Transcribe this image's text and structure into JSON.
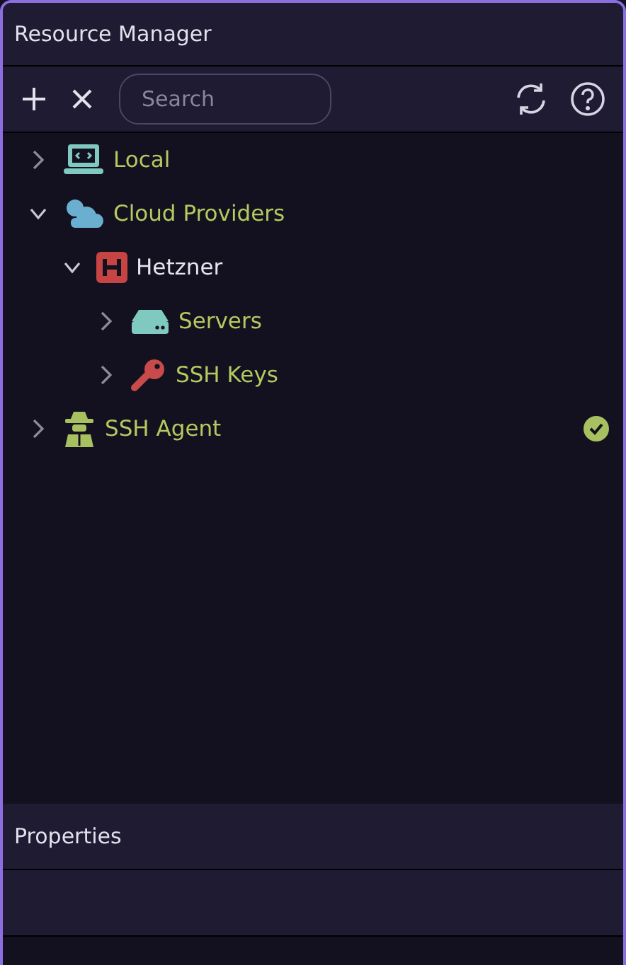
{
  "window": {
    "title": "Resource Manager"
  },
  "toolbar": {
    "search": {
      "placeholder": "Search"
    }
  },
  "tree": [
    {
      "label": "Local",
      "kind": "local",
      "expanded": false,
      "connected": false
    },
    {
      "label": "Cloud Providers",
      "kind": "cloud",
      "expanded": true,
      "connected": false,
      "children": [
        {
          "label": "Hetzner",
          "kind": "provider",
          "expanded": true,
          "connected": false,
          "children": [
            {
              "label": "Servers",
              "kind": "servers",
              "expanded": false,
              "connected": false
            },
            {
              "label": "SSH Keys",
              "kind": "keys",
              "expanded": false,
              "connected": false
            }
          ]
        }
      ]
    },
    {
      "label": "SSH Agent",
      "kind": "agent",
      "expanded": false,
      "connected": true
    }
  ],
  "properties": {
    "title": "Properties"
  }
}
